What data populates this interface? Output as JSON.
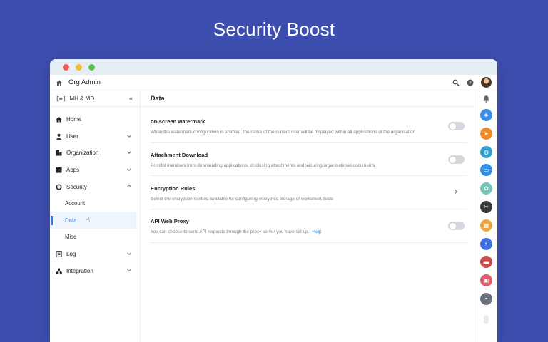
{
  "hero": {
    "title": "Security Boost"
  },
  "window": {
    "app_title": "Org Admin"
  },
  "sidebar": {
    "org_badge": "[≡]",
    "org_name": "MH & MD",
    "collapse_glyph": "«",
    "items": [
      {
        "label": "Home",
        "icon": "home-icon"
      },
      {
        "label": "User",
        "icon": "user-icon",
        "expandable": true
      },
      {
        "label": "Organization",
        "icon": "organization-icon",
        "expandable": true
      },
      {
        "label": "Apps",
        "icon": "apps-icon",
        "expandable": true
      },
      {
        "label": "Security",
        "icon": "shield-icon",
        "expandable": true,
        "expanded": true
      },
      {
        "label": "Log",
        "icon": "log-icon",
        "expandable": true
      },
      {
        "label": "Integration",
        "icon": "integration-icon",
        "expandable": true
      }
    ],
    "security_sub": [
      {
        "label": "Account"
      },
      {
        "label": "Data",
        "active": true
      },
      {
        "label": "Misc"
      }
    ]
  },
  "main": {
    "title": "Data",
    "settings": [
      {
        "title": "on-screen watermark",
        "description": "When the watermark configuration is enabled, the name of the current user will be displayed within all applications of the organisation",
        "control": "toggle",
        "enabled": false
      },
      {
        "title": "Attachment Download",
        "description": "Prohibit members from downloading applications, disclosing attachments and securing organisational documents",
        "control": "toggle",
        "enabled": false
      },
      {
        "title": "Encryption Rules",
        "description": "Select the encryption method available for configuring encrypted storage of worksheet fields",
        "control": "arrow"
      },
      {
        "title": "API Web Proxy",
        "description": "You can choose to send API requests through the proxy server you have set up.",
        "help_link": "Help",
        "control": "toggle",
        "enabled": false
      }
    ]
  },
  "rail": {
    "apps": [
      {
        "icon": "team-app-icon",
        "color": "#3a8ee6"
      },
      {
        "icon": "send-app-icon",
        "color": "#f08a24"
      },
      {
        "icon": "globe-app-icon",
        "color": "#2f9fcf"
      },
      {
        "icon": "chat-app-icon",
        "color": "#2f8fe8"
      },
      {
        "icon": "photo-app-icon",
        "color": "#76c3b8"
      },
      {
        "icon": "tool-app-icon",
        "color": "#3a3a3a"
      },
      {
        "icon": "grid-app-icon",
        "color": "#f0a640"
      },
      {
        "icon": "bolt-app-icon",
        "color": "#3d6fe0"
      },
      {
        "icon": "image-app-icon",
        "color": "#c94b4b"
      },
      {
        "icon": "calendar-app-icon",
        "color": "#e35b6b"
      },
      {
        "icon": "ghost-app-icon",
        "color": "#6a7280"
      }
    ]
  },
  "colors": {
    "background": "#3d4eae",
    "accent": "#2d7fd8",
    "active_bg": "#eef5fc"
  }
}
